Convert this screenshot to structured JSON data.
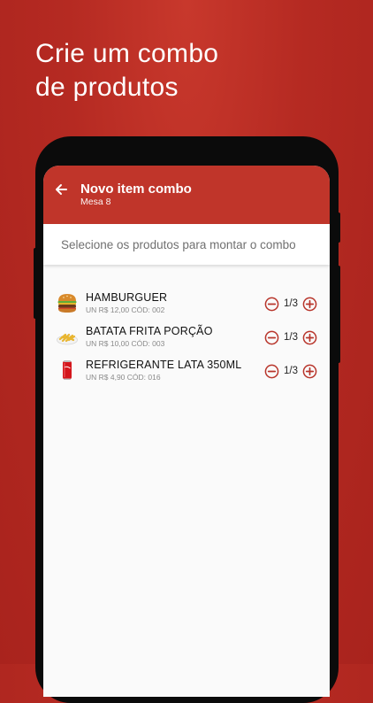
{
  "promo": {
    "line1": "Crie um combo",
    "line2": "de produtos"
  },
  "appbar": {
    "title": "Novo item combo",
    "subtitle": "Mesa 8",
    "back_icon": "arrow-left-icon"
  },
  "hint": "Selecione os produtos para montar o combo",
  "products": [
    {
      "name": "HAMBURGUER",
      "meta": "UN R$ 12,00 CÓD: 002",
      "qty": "1/3",
      "icon": "burger-icon"
    },
    {
      "name": "BATATA FRITA PORÇÃO",
      "meta": "UN R$ 10,00 CÓD: 003",
      "qty": "1/3",
      "icon": "fries-icon"
    },
    {
      "name": "REFRIGERANTE LATA 350ML",
      "meta": "UN R$ 4,90 CÓD: 016",
      "qty": "1/3",
      "icon": "soda-can-icon"
    }
  ],
  "colors": {
    "brand": "#c0352a",
    "background": "#a9231d",
    "accent": "#b8352b"
  }
}
